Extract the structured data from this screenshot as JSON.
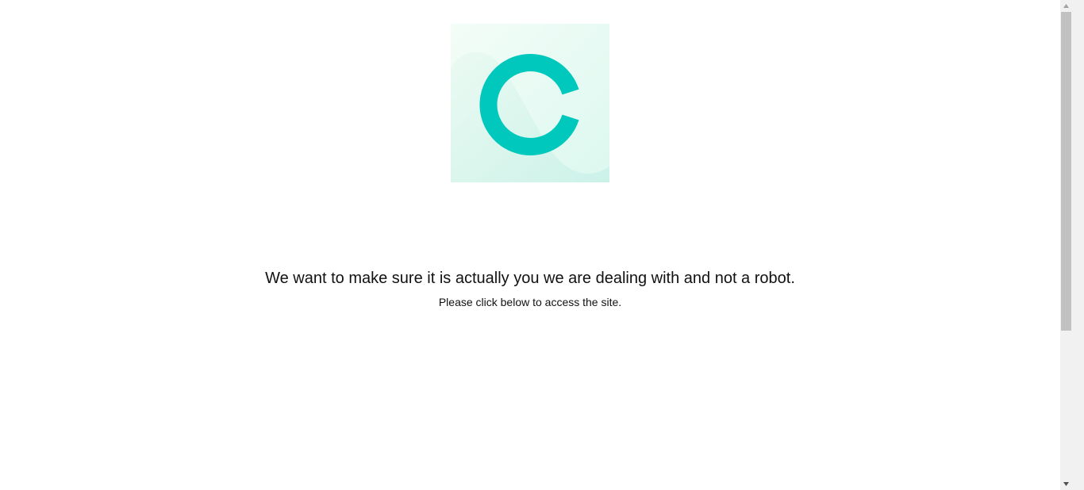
{
  "logo": {
    "icon": "brand-c-logo-icon",
    "accent_color": "#00c8bd",
    "background_color": "#e6fbf4"
  },
  "message": {
    "headline": "We want to make sure it is actually you we are dealing with and not a robot.",
    "subline": "Please click below to access the site."
  },
  "scrollbar": {
    "up_icon": "scroll-up-arrow-icon",
    "down_icon": "scroll-down-arrow-icon"
  }
}
